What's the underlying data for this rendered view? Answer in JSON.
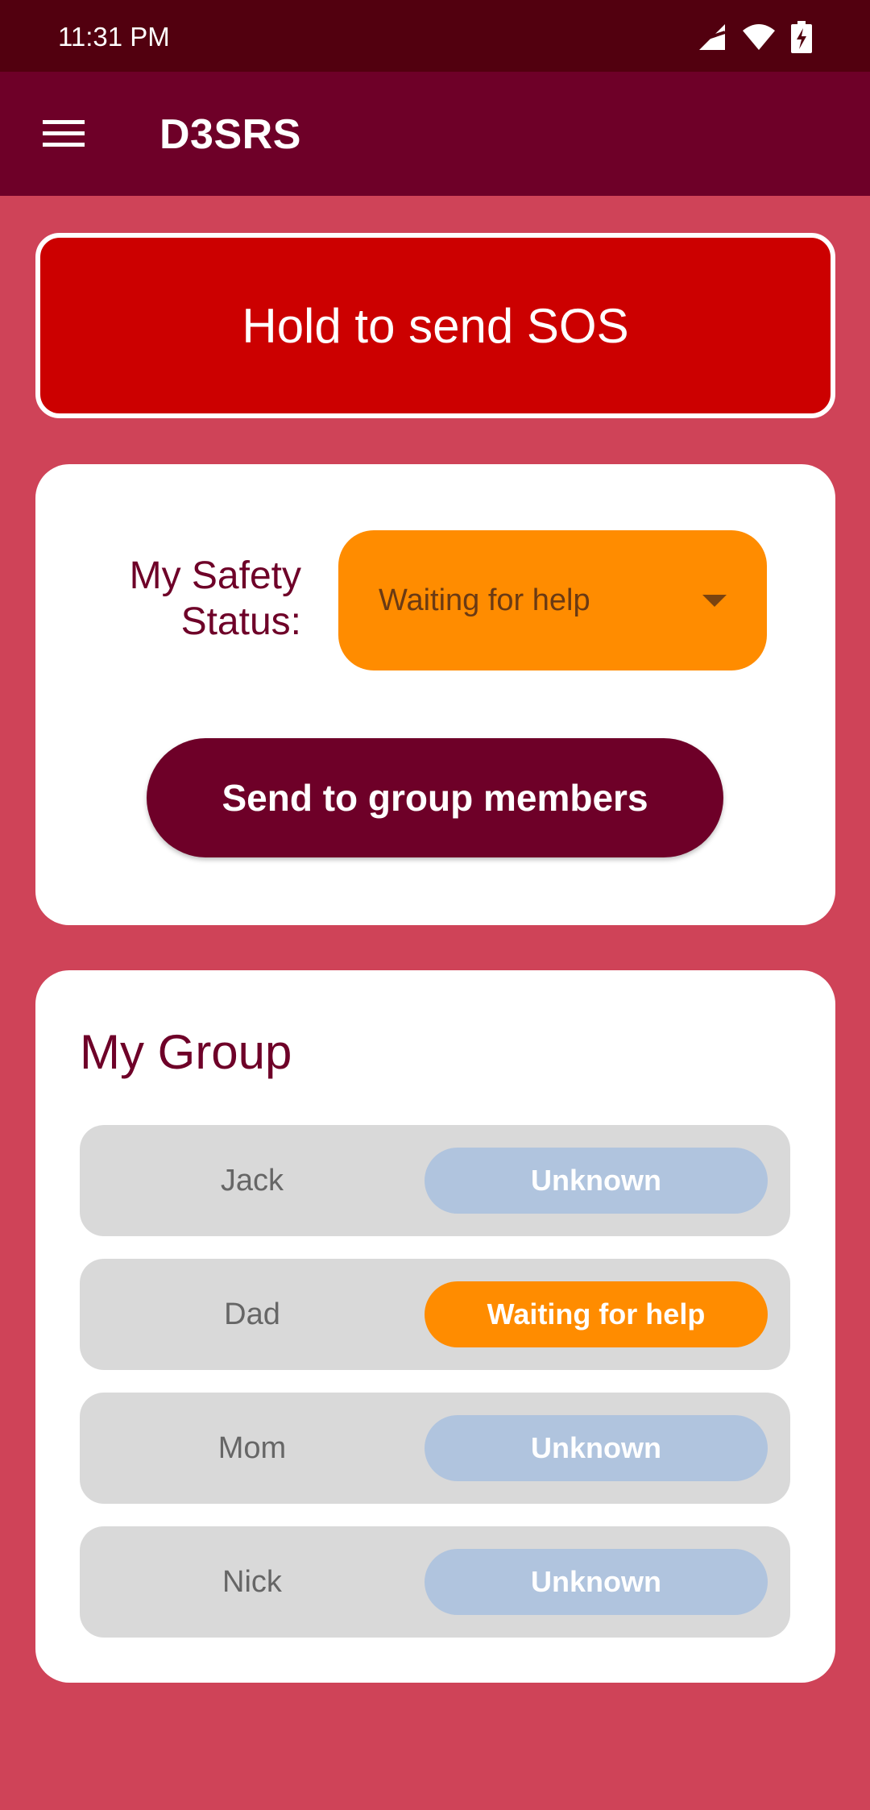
{
  "status_bar": {
    "time": "11:31 PM",
    "icons": [
      "signal-icon",
      "wifi-icon",
      "battery-charging-icon"
    ]
  },
  "app_bar": {
    "menu_icon": "menu-icon",
    "title": "D3SRS"
  },
  "sos": {
    "label": "Hold to send SOS"
  },
  "safety": {
    "label_line1": "My Safety",
    "label_line2": "Status:",
    "selected": "Waiting for help",
    "send_label": "Send to group members"
  },
  "group": {
    "title": "My Group",
    "members": [
      {
        "name": "Jack",
        "status": "Unknown"
      },
      {
        "name": "Dad",
        "status": "Waiting for help"
      },
      {
        "name": "Mom",
        "status": "Unknown"
      },
      {
        "name": "Nick",
        "status": "Unknown"
      }
    ]
  },
  "colors": {
    "background": "#cf4358",
    "app_bar": "#6e0028",
    "status_bar": "#52000f",
    "sos": "#cc0000",
    "waiting": "#ff8c00",
    "unknown": "#b0c4de"
  }
}
